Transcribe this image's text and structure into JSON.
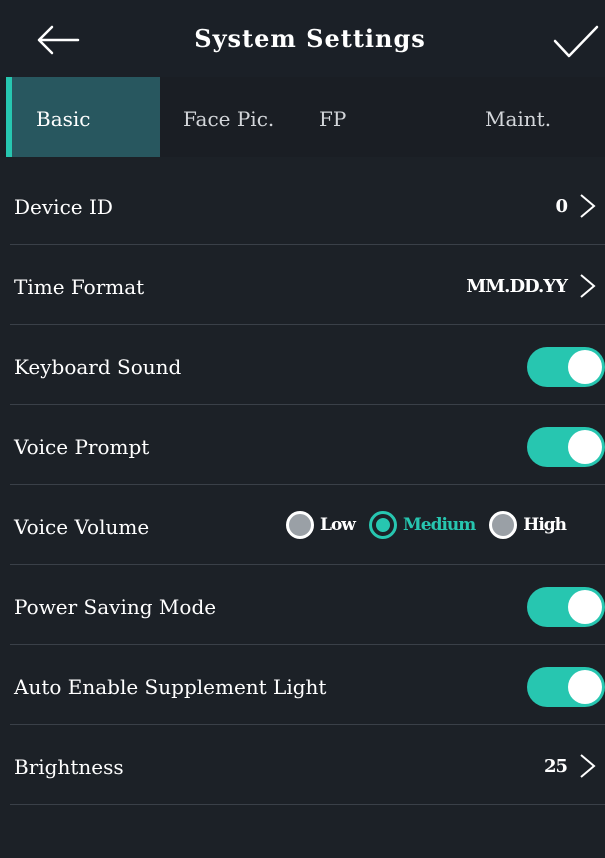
{
  "header": {
    "title": "System Settings",
    "back_icon": "arrow-left-icon",
    "confirm_icon": "checkmark-icon"
  },
  "tabs": [
    {
      "label": "Basic",
      "active": true
    },
    {
      "label": "Face Pic.",
      "active": false
    },
    {
      "label": "FP",
      "active": false
    },
    {
      "label": "Maint.",
      "active": false
    }
  ],
  "settings": {
    "device_id": {
      "label": "Device ID",
      "value": "0"
    },
    "time_format": {
      "label": "Time Format",
      "value": "MM.DD.YY"
    },
    "keyboard_sound": {
      "label": "Keyboard Sound",
      "enabled": true
    },
    "voice_prompt": {
      "label": "Voice Prompt",
      "enabled": true
    },
    "voice_volume": {
      "label": "Voice Volume",
      "options": [
        "Low",
        "Medium",
        "High"
      ],
      "selected": "Medium"
    },
    "power_saving_mode": {
      "label": "Power Saving Mode",
      "enabled": true
    },
    "auto_supplement_light": {
      "label": "Auto Enable Supplement Light",
      "enabled": true
    },
    "brightness": {
      "label": "Brightness",
      "value": "25"
    }
  },
  "colors": {
    "accent": "#27c6b0",
    "background": "#1c2127",
    "active_tab": "#28575f"
  }
}
